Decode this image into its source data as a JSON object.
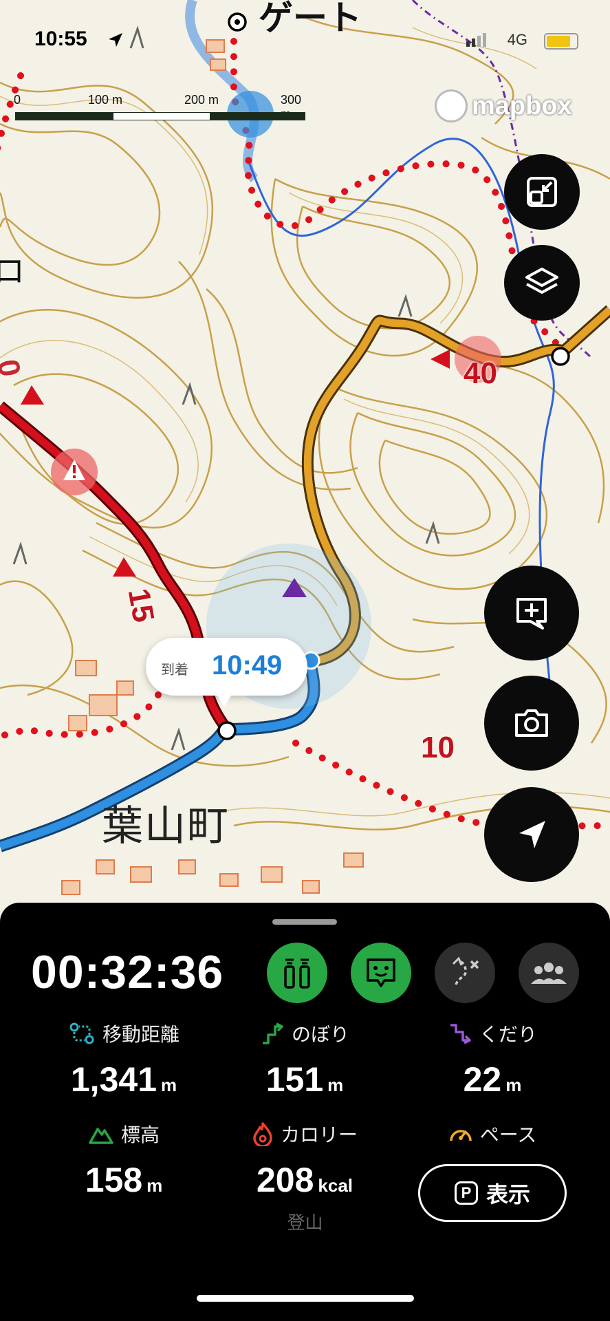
{
  "status_bar": {
    "time": "10:55",
    "network": "4G"
  },
  "map": {
    "labels": {
      "gate": "ゲート",
      "town": "葉山町"
    },
    "scale": {
      "ticks": [
        "0",
        "100 m",
        "200 m",
        "300 m"
      ]
    },
    "attribution": "mapbox",
    "route_markers": [
      "40",
      "15",
      "10"
    ],
    "arrival_tooltip": {
      "label": "到着",
      "time": "10:49"
    },
    "colors": {
      "recorded_track": "#2f8fe0",
      "planned_route": "#d4101c",
      "alt_route": "#e3a128",
      "dotted_trail": "#e0101d"
    }
  },
  "map_buttons": [
    {
      "name": "fit-screen-button",
      "icon": "fit-screen-icon"
    },
    {
      "name": "layers-button",
      "icon": "layers-icon"
    },
    {
      "name": "add-memo-button",
      "icon": "add-memo-icon"
    },
    {
      "name": "camera-button",
      "icon": "camera-icon"
    },
    {
      "name": "current-location-button",
      "icon": "location-arrow-icon"
    }
  ],
  "panel": {
    "timer": "00:32:36",
    "stats": {
      "distance": {
        "label": "移動距離",
        "value": "1,341",
        "unit": "m"
      },
      "ascent": {
        "label": "のぼり",
        "value": "151",
        "unit": "m"
      },
      "descent": {
        "label": "くだり",
        "value": "22",
        "unit": "m"
      },
      "elevation": {
        "label": "標高",
        "value": "158",
        "unit": "m"
      },
      "calories": {
        "label": "カロリー",
        "value": "208",
        "unit": "kcal"
      },
      "pace": {
        "label": "ペース"
      }
    },
    "show_button": {
      "badge": "P",
      "label": "表示"
    },
    "activity_type": "登山",
    "colors": {
      "accent_green": "#27a844",
      "distance": "#2bb3c8",
      "ascent": "#27a844",
      "descent": "#9b59d6",
      "elevation": "#27a844",
      "calories": "#e8432c",
      "pace": "#f0a830"
    }
  }
}
